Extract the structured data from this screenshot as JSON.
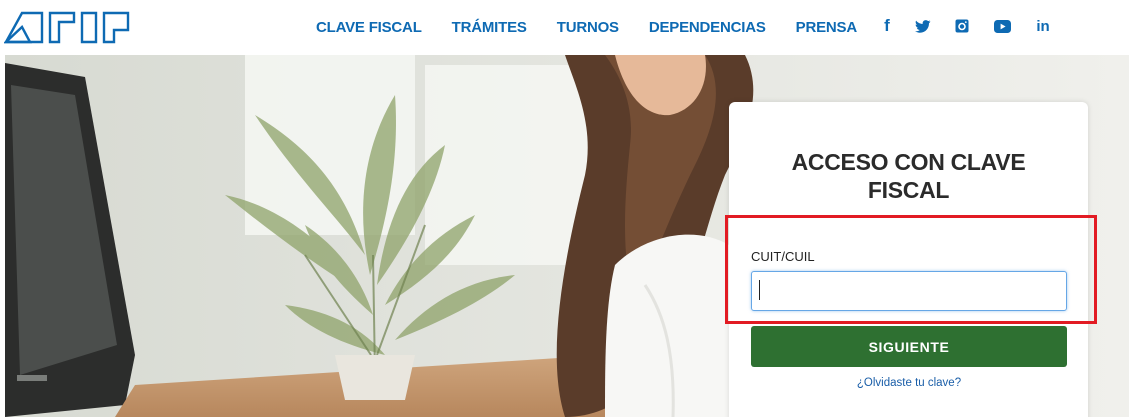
{
  "header": {
    "logo_text": "AFIP",
    "nav": [
      {
        "label": "CLAVE FISCAL"
      },
      {
        "label": "TRÁMITES"
      },
      {
        "label": "TURNOS"
      },
      {
        "label": "DEPENDENCIAS"
      },
      {
        "label": "PRENSA"
      }
    ],
    "social": [
      {
        "name": "facebook-icon",
        "glyph": "f"
      },
      {
        "name": "twitter-icon",
        "glyph": ""
      },
      {
        "name": "instagram-icon",
        "glyph": ""
      },
      {
        "name": "youtube-icon",
        "glyph": ""
      },
      {
        "name": "linkedin-icon",
        "glyph": "in"
      }
    ]
  },
  "login": {
    "title": "ACCESO CON CLAVE FISCAL",
    "field_label": "CUIT/CUIL",
    "field_value": "",
    "field_placeholder": "",
    "submit_label": "SIGUIENTE",
    "forgot_link": "¿Olvidaste tu clave?"
  },
  "colors": {
    "brand_blue": "#0e6ab3",
    "button_green": "#2e7031",
    "highlight_red": "#e21b23"
  }
}
